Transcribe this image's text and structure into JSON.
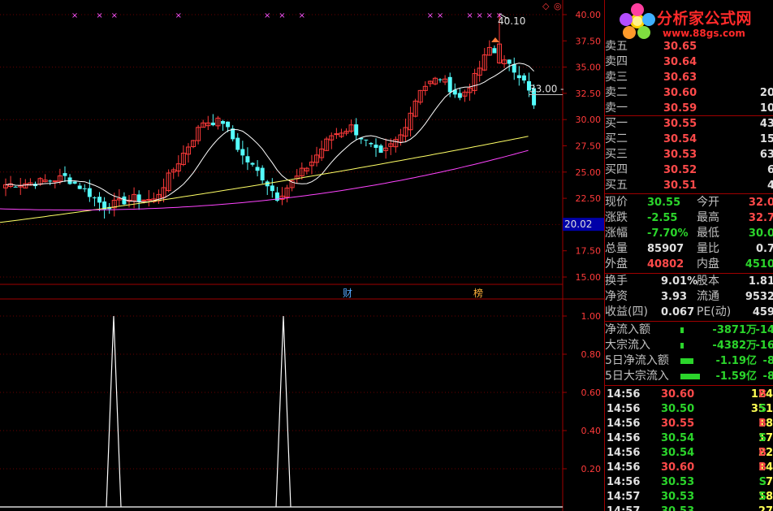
{
  "chart": {
    "price_axis": [
      "40.00",
      "37.50",
      "35.00",
      "32.50",
      "30.00",
      "27.50",
      "25.00",
      "22.50",
      "20.00",
      "17.50",
      "15.00"
    ],
    "high_label": "40.10",
    "current_tag": "33.00",
    "low_tag": "20.02",
    "markers": [
      "财",
      "榜"
    ],
    "indicator_axis": [
      "1.00",
      "0.80",
      "0.60",
      "0.40",
      "0.20"
    ],
    "colors": {
      "up": "#ff3a3a",
      "down": "#54fcfc",
      "ma_short": "#ffffff",
      "ma_mid": "#ffff66",
      "ma_long": "#ff44ff",
      "magenta_x": "#ff55ff"
    }
  },
  "quote": {
    "sell": [
      {
        "label": "卖五",
        "price": "30.65",
        "vol": ""
      },
      {
        "label": "卖四",
        "price": "30.64",
        "vol": ""
      },
      {
        "label": "卖三",
        "price": "30.63",
        "vol": ""
      },
      {
        "label": "卖二",
        "price": "30.60",
        "vol": "20"
      },
      {
        "label": "卖一",
        "price": "30.59",
        "vol": "10"
      }
    ],
    "buy": [
      {
        "label": "买一",
        "price": "30.55",
        "vol": "43"
      },
      {
        "label": "买二",
        "price": "30.54",
        "vol": "15"
      },
      {
        "label": "买三",
        "price": "30.53",
        "vol": "63"
      },
      {
        "label": "买四",
        "price": "30.52",
        "vol": "6"
      },
      {
        "label": "买五",
        "price": "30.51",
        "vol": "4"
      }
    ],
    "stats": [
      {
        "l1": "现价",
        "v1": "30.55",
        "c1": "green",
        "l2": "今开",
        "v2": "32.0",
        "c2": "red"
      },
      {
        "l1": "涨跌",
        "v1": "-2.55",
        "c1": "green",
        "l2": "最高",
        "v2": "32.7",
        "c2": "red"
      },
      {
        "l1": "涨幅",
        "v1": "-7.70%",
        "c1": "green",
        "l2": "最低",
        "v2": "30.0",
        "c2": "green"
      },
      {
        "l1": "总量",
        "v1": "85907",
        "c1": "white",
        "l2": "量比",
        "v2": "0.7",
        "c2": "white"
      },
      {
        "l1": "外盘",
        "v1": "40802",
        "c1": "red",
        "l2": "内盘",
        "v2": "4510",
        "c2": "green"
      }
    ],
    "fund": [
      {
        "l1": "换手",
        "v1": "9.01%",
        "l2": "股本",
        "v2": "1.81"
      },
      {
        "l1": "净资",
        "v1": "3.93",
        "l2": "流通",
        "v2": "9532"
      },
      {
        "l1": "收益(四)",
        "v1": "0.067",
        "l2": "PE(动)",
        "v2": "459"
      }
    ],
    "flow": [
      {
        "label": "净流入额",
        "val": "-3871万",
        "tail": "-14",
        "bar": 4
      },
      {
        "label": "大宗流入",
        "val": "-4382万",
        "tail": "-16",
        "bar": 4
      },
      {
        "label": "5日净流入额",
        "val": "-1.19亿",
        "tail": "-8",
        "bar": 16
      },
      {
        "label": "5日大宗流入",
        "val": "-1.59亿",
        "tail": "-8",
        "bar": 24
      }
    ],
    "ticks": [
      {
        "time": "14:56",
        "price": "30.60",
        "vol": "124",
        "side": "B"
      },
      {
        "time": "14:56",
        "price": "30.50",
        "vol": "351",
        "side": "S"
      },
      {
        "time": "14:56",
        "price": "30.55",
        "vol": "18",
        "side": "B"
      },
      {
        "time": "14:56",
        "price": "30.54",
        "vol": "17",
        "side": "S"
      },
      {
        "time": "14:56",
        "price": "30.54",
        "vol": "22",
        "side": "B"
      },
      {
        "time": "14:56",
        "price": "30.60",
        "vol": "14",
        "side": "B"
      },
      {
        "time": "14:56",
        "price": "30.53",
        "vol": "7",
        "side": "S"
      },
      {
        "time": "14:57",
        "price": "30.53",
        "vol": "18",
        "side": "S"
      },
      {
        "time": "14:57",
        "price": "30.53",
        "vol": "27",
        "side": ""
      }
    ]
  },
  "logo": {
    "text": "分析家公式网",
    "url": "www.88gs.com"
  }
}
